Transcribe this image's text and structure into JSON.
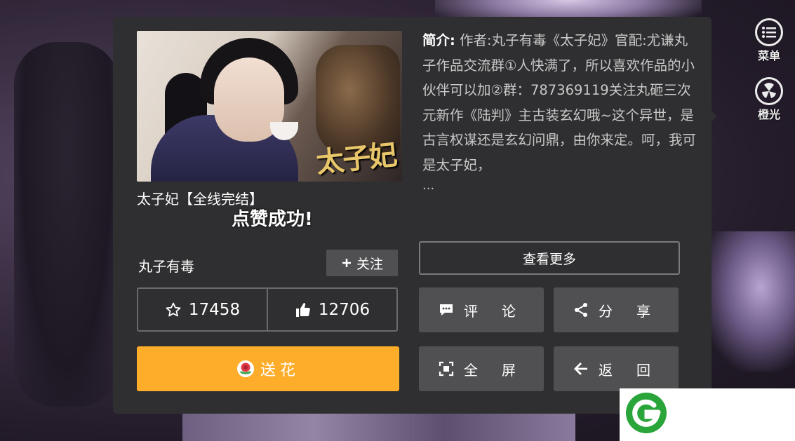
{
  "book": {
    "title": "太子妃【全线完结】",
    "cover_text": "太子妃",
    "intro_label": "简介:",
    "intro_text": "作者:丸子有毒《太子妃》官配:尤谦丸子作品交流群①人快满了，所以喜欢作品的小伙伴可以加②群：787369119关注丸砸三次元新作《陆判》主古装玄幻哦~这个异世，是古言权谋还是玄幻问鼎，由你来定。呵，我可是太子妃，",
    "ellipsis": "..."
  },
  "toast": "点赞成功!",
  "author": {
    "name": "丸子有毒",
    "follow_label": "关注",
    "follow_icon": "plus-icon"
  },
  "more_label": "查看更多",
  "stats": {
    "favorites": "17458",
    "favorites_icon": "star-outline-icon",
    "likes": "12706",
    "likes_icon": "thumbs-up-icon"
  },
  "flower": {
    "label": "送花",
    "icon": "flower-icon",
    "color": "#fdad29"
  },
  "actions": {
    "comment": "评论",
    "share": "分享",
    "fullscreen": "全屏",
    "back": "返回"
  },
  "side_menu": {
    "menu_label": "菜单",
    "orange_label": "橙光"
  },
  "colors": {
    "dialog_bg": "#2f2f31",
    "button_bg": "#505052",
    "logo_green": "#2aa53a"
  }
}
